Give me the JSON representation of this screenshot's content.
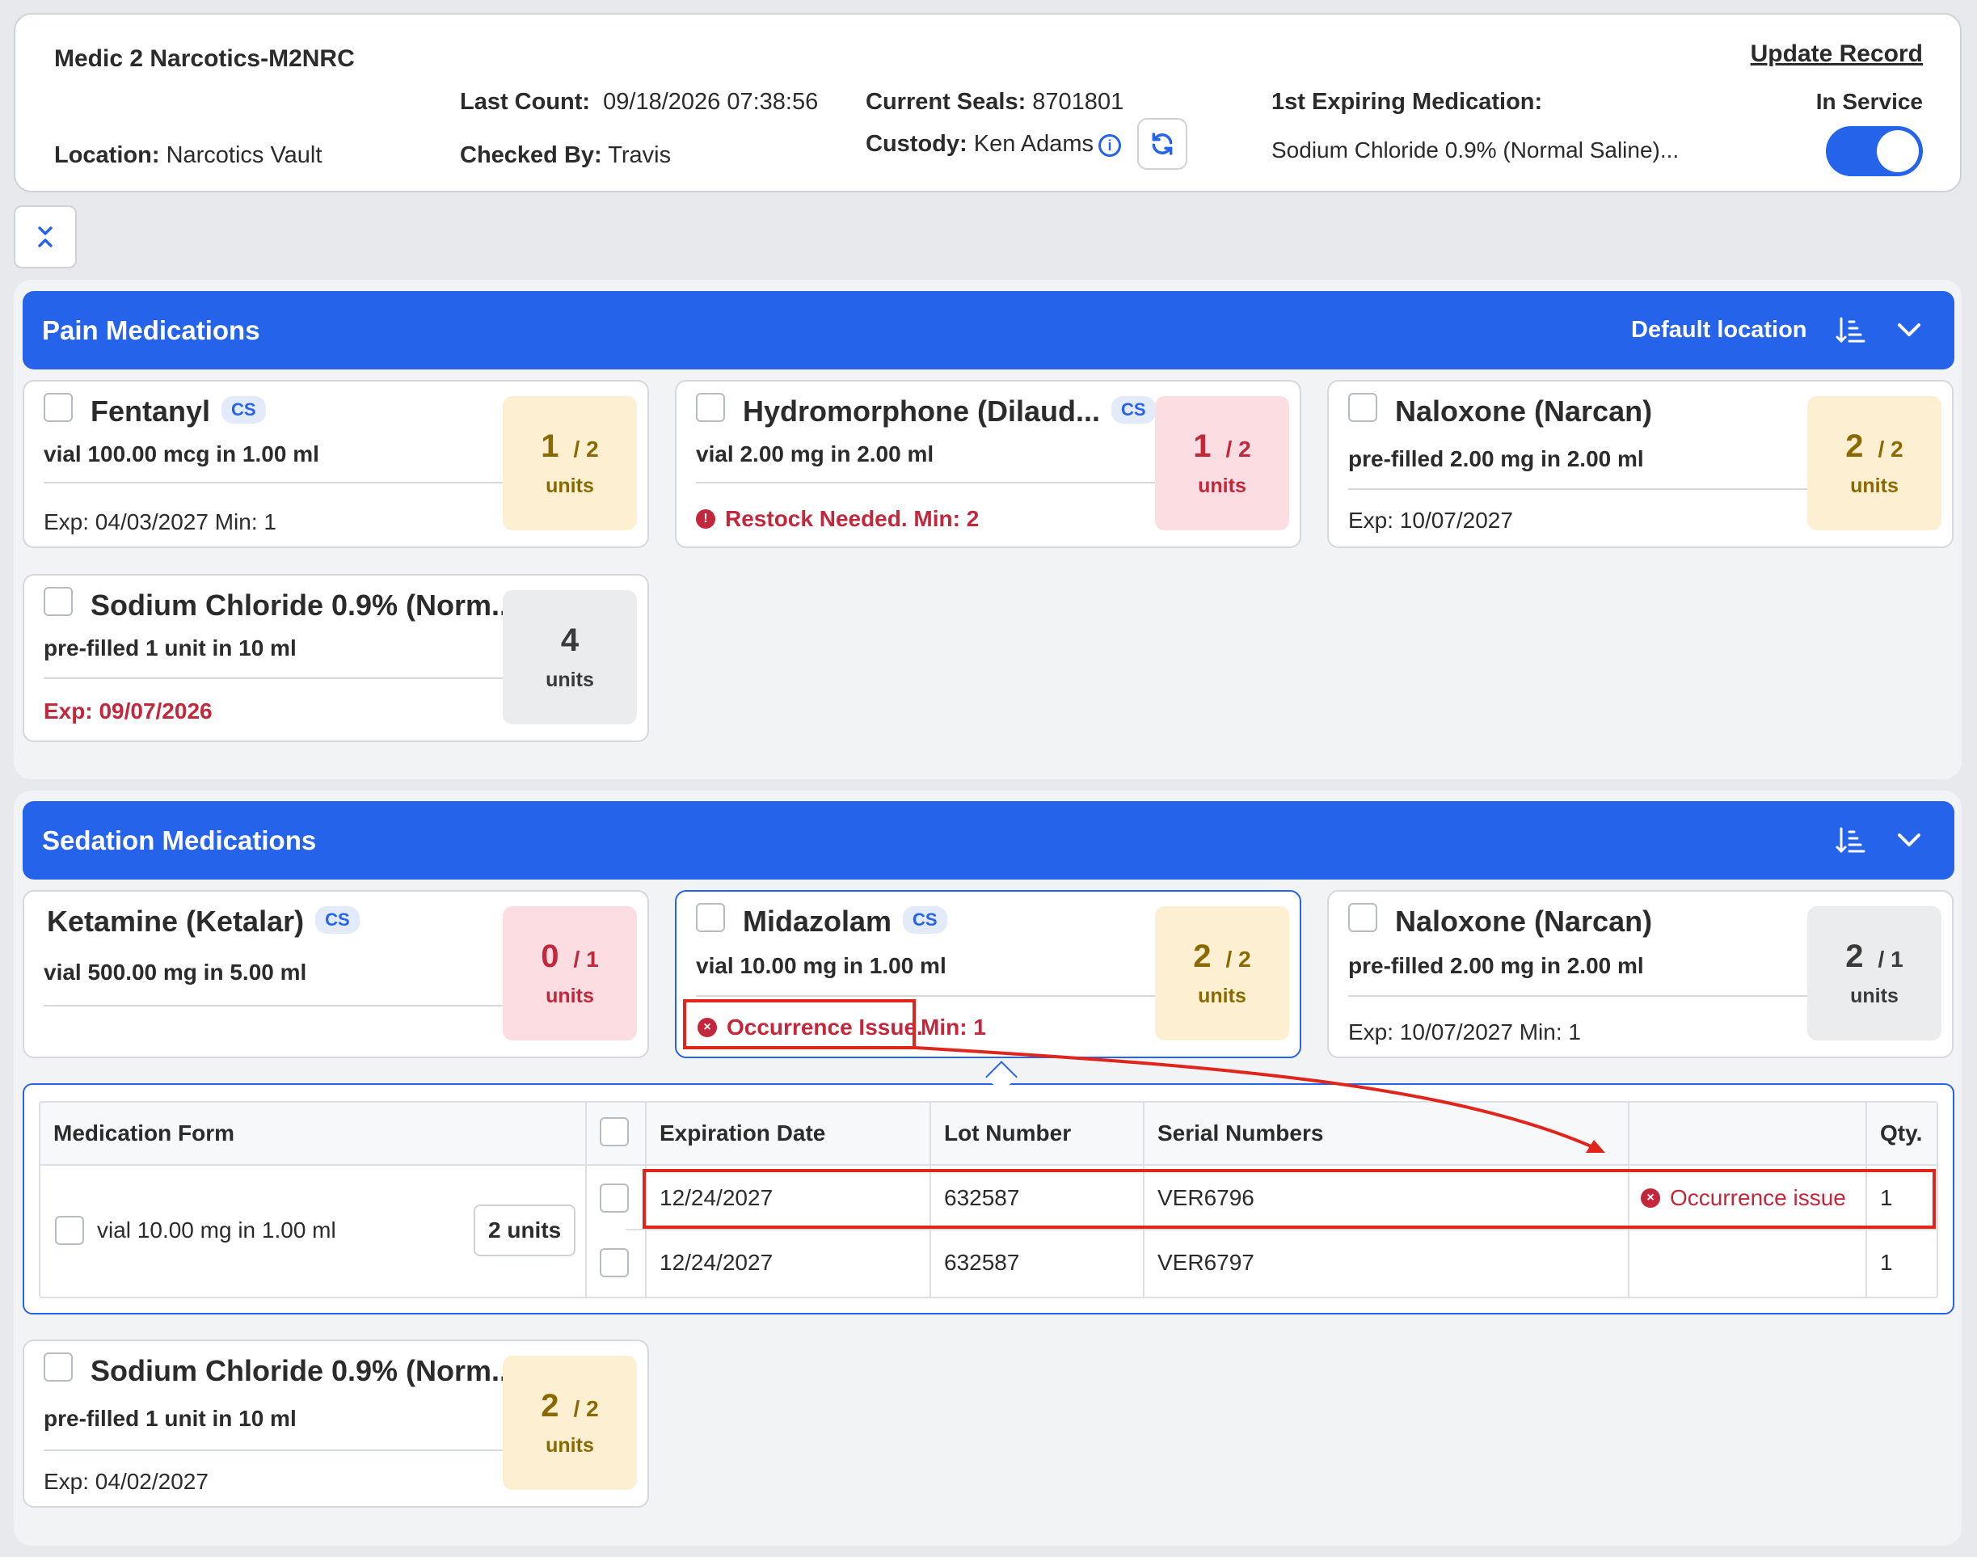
{
  "header": {
    "title": "Medic 2 Narcotics-M2NRC",
    "location_label": "Location:",
    "location_value": "Narcotics Vault",
    "last_count_label": "Last Count:",
    "last_count_value": "09/18/2026 07:38:56",
    "checked_by_label": "Checked By:",
    "checked_by_value": "Travis",
    "current_seals_label": "Current Seals:",
    "current_seals_value": "8701801",
    "custody_label": "Custody:",
    "custody_value": "Ken Adams",
    "first_expiring_label": "1st Expiring Medication:",
    "first_expiring_value": "Sodium Chloride 0.9% (Normal Saline)...",
    "update_record": "Update Record",
    "in_service_label": "In Service",
    "in_service": true
  },
  "pain": {
    "title": "Pain Medications",
    "default_location": "Default location",
    "cards": [
      {
        "name": "Fentanyl",
        "badge": "CS",
        "form": "vial 100.00 mcg in 1.00 ml",
        "footer": "Exp: 04/03/2027 Min: 1",
        "qty": "1",
        "of": "/ 2",
        "unit": "units"
      },
      {
        "name": "Hydromorphone (Dilaud...",
        "badge": "CS",
        "form": "vial 2.00 mg in 2.00 ml",
        "footer": "Restock Needed.  Min: 2",
        "qty": "1",
        "of": "/ 2",
        "unit": "units"
      },
      {
        "name": "Naloxone (Narcan)",
        "form": "pre-filled 2.00 mg in 2.00 ml",
        "footer": "Exp: 10/07/2027",
        "qty": "2",
        "of": "/ 2",
        "unit": "units"
      },
      {
        "name": "Sodium Chloride 0.9% (Norm...",
        "form": "pre-filled 1 unit in 10 ml",
        "footer": "Exp: 09/07/2026",
        "qty": "4",
        "unit": "units"
      }
    ]
  },
  "sedation": {
    "title": "Sedation Medications",
    "cards": [
      {
        "name": "Ketamine (Ketalar)",
        "badge": "CS",
        "form": "vial 500.00 mg in 5.00 ml",
        "qty": "0",
        "of": "/ 1",
        "unit": "units"
      },
      {
        "name": "Midazolam",
        "badge": "CS",
        "form": "vial 10.00 mg in 1.00 ml",
        "footer_issue": "Occurrence Issue.",
        "footer_min": "Min: 1",
        "qty": "2",
        "of": "/ 2",
        "unit": "units"
      },
      {
        "name": "Naloxone (Narcan)",
        "form": "pre-filled 2.00 mg in 2.00 ml",
        "footer": "Exp: 10/07/2027 Min: 1",
        "qty": "2",
        "of": "/ 1",
        "unit": "units"
      },
      {
        "name": "Sodium Chloride 0.9% (Norm...",
        "form": "pre-filled 1 unit in 10 ml",
        "footer": "Exp: 04/02/2027",
        "qty": "2",
        "of": "/ 2",
        "unit": "units"
      }
    ]
  },
  "detail": {
    "headers": {
      "form": "Medication Form",
      "exp": "Expiration Date",
      "lot": "Lot Number",
      "serial": "Serial Numbers",
      "qty": "Qty."
    },
    "form_label": "vial 10.00 mg in 1.00 ml",
    "form_units": "2 units",
    "rows": [
      {
        "exp": "12/24/2027",
        "lot": "632587",
        "serial": "VER6796",
        "status": "Occurrence issue",
        "qty": "1"
      },
      {
        "exp": "12/24/2027",
        "lot": "632587",
        "serial": "VER6797",
        "status": "",
        "qty": "1"
      }
    ]
  },
  "colors": {
    "accent": "#2563eb",
    "alert": "#c2273b",
    "annotation": "#e0261c"
  }
}
